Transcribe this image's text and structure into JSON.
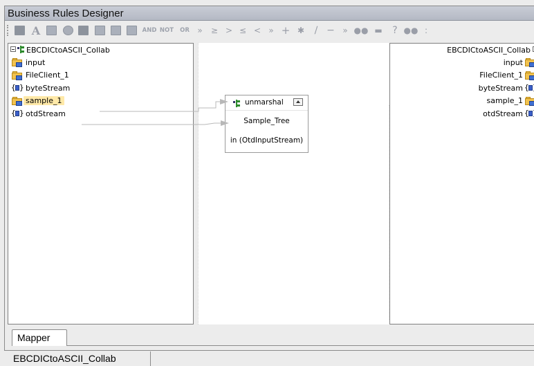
{
  "window": {
    "title": "Business Rules Designer"
  },
  "toolbar": {
    "text_buttons": {
      "and": "AND",
      "not": "NOT",
      "or": "OR"
    }
  },
  "source_tree": {
    "root": "EBCDICtoASCII_Collab",
    "items": [
      {
        "label": "input",
        "icon": "folder-icon",
        "selected": false
      },
      {
        "label": "FileClient_1",
        "icon": "folder-icon",
        "selected": false
      },
      {
        "label": "byteStream",
        "icon": "brace-icon",
        "selected": false
      },
      {
        "label": "sample_1",
        "icon": "folder-icon",
        "selected": true
      },
      {
        "label": "otdStream",
        "icon": "brace-icon",
        "selected": false
      }
    ]
  },
  "method_box": {
    "title": "unmarshal",
    "ports": [
      "Sample_Tree",
      "in (OtdInputStream)"
    ]
  },
  "target_tree": {
    "root": "EBCDICtoASCII_Collab",
    "items": [
      {
        "label": "input",
        "icon": "folder-icon"
      },
      {
        "label": "FileClient_1",
        "icon": "folder-icon"
      },
      {
        "label": "byteStream",
        "icon": "brace-icon"
      },
      {
        "label": "sample_1",
        "icon": "folder-icon"
      },
      {
        "label": "otdStream",
        "icon": "brace-icon"
      }
    ]
  },
  "tabs": {
    "mapper": "Mapper"
  },
  "document_tab": {
    "label": "EBCDICtoASCII_Collab"
  },
  "colors": {
    "selection": "#ffe9a8",
    "link_line": "#b8b8b8",
    "titlebar": "#c0c5cf"
  }
}
